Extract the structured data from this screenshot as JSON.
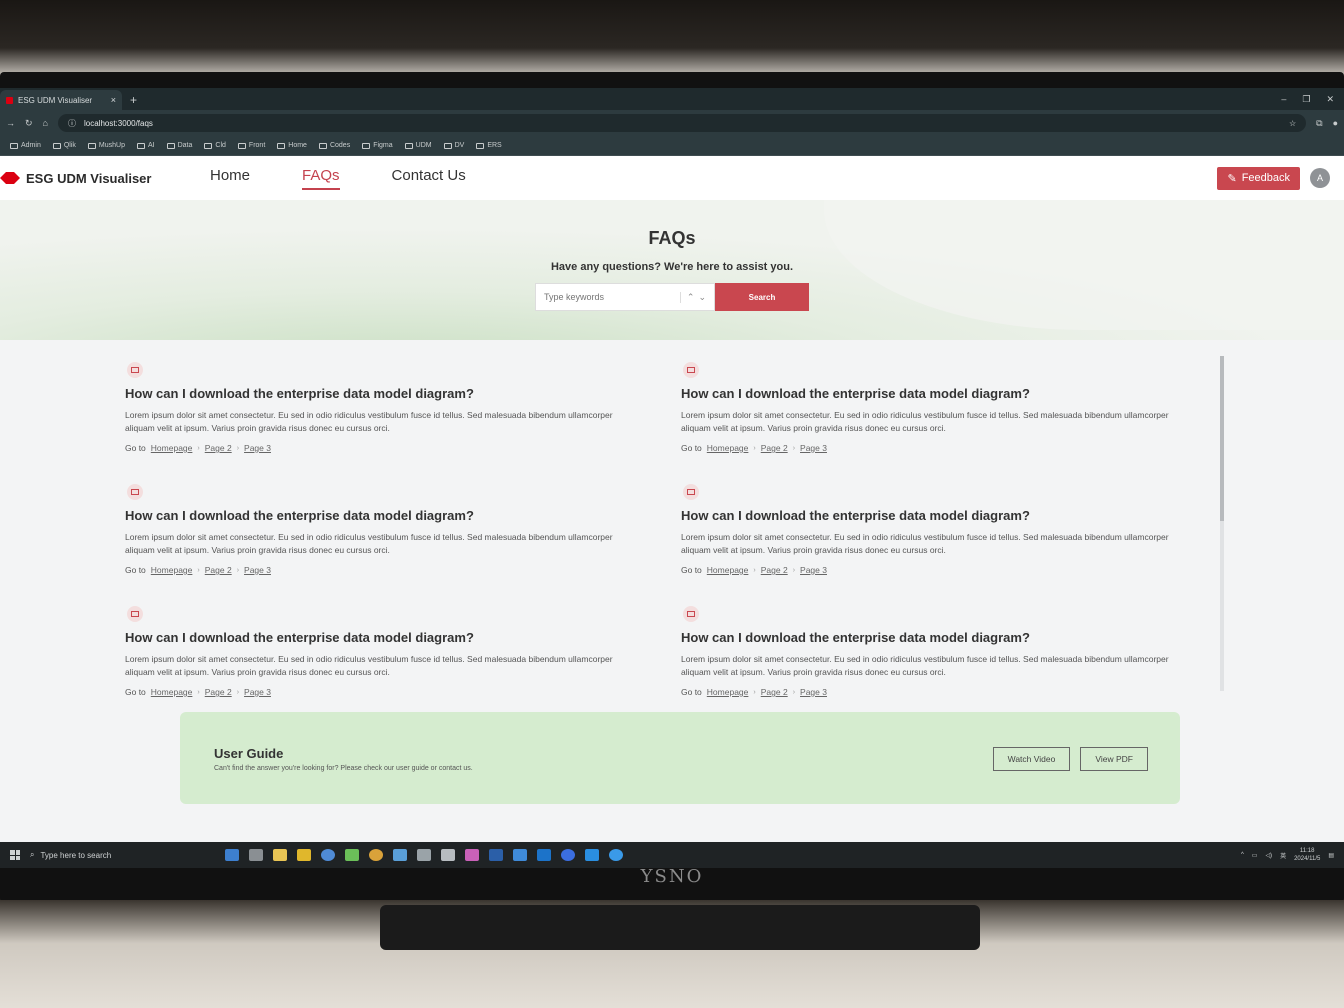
{
  "browser": {
    "tab_title": "ESG UDM Visualiser",
    "tab_close": "×",
    "new_tab": "+",
    "url": "localhost:3000/faqs",
    "bookmarks": [
      "Admin",
      "Qlik",
      "MushUp",
      "AI",
      "Data",
      "Cld",
      "Front",
      "Home",
      "Codes",
      "Figma",
      "UDM",
      "DV",
      "ERS"
    ]
  },
  "header": {
    "app_name": "ESG UDM Visualiser",
    "nav": [
      "Home",
      "FAQs",
      "Contact Us"
    ],
    "active_nav": "FAQs",
    "feedback_label": "Feedback",
    "avatar_initial": "A"
  },
  "hero": {
    "title": "FAQs",
    "subtitle": "Have any questions? We're here to assist you.",
    "search_placeholder": "Type keywords",
    "search_button": "Search"
  },
  "faqs": [
    {
      "question": "How can I download the enterprise data model diagram?",
      "answer": "Lorem ipsum dolor sit amet consectetur. Eu sed in odio ridiculus vestibulum fusce id tellus. Sed malesuada bibendum ullamcorper aliquam velit at ipsum. Varius proin gravida risus donec eu cursus orci.",
      "goto": "Go to",
      "links": [
        "Homepage",
        "Page 2",
        "Page 3"
      ]
    },
    {
      "question": "How can I download the enterprise data model diagram?",
      "answer": "Lorem ipsum dolor sit amet consectetur. Eu sed in odio ridiculus vestibulum fusce id tellus. Sed malesuada bibendum ullamcorper aliquam velit at ipsum. Varius proin gravida risus donec eu cursus orci.",
      "goto": "Go to",
      "links": [
        "Homepage",
        "Page 2",
        "Page 3"
      ]
    },
    {
      "question": "How can I download the enterprise data model diagram?",
      "answer": "Lorem ipsum dolor sit amet consectetur. Eu sed in odio ridiculus vestibulum fusce id tellus. Sed malesuada bibendum ullamcorper aliquam velit at ipsum. Varius proin gravida risus donec eu cursus orci.",
      "goto": "Go to",
      "links": [
        "Homepage",
        "Page 2",
        "Page 3"
      ]
    },
    {
      "question": "How can I download the enterprise data model diagram?",
      "answer": "Lorem ipsum dolor sit amet consectetur. Eu sed in odio ridiculus vestibulum fusce id tellus. Sed malesuada bibendum ullamcorper aliquam velit at ipsum. Varius proin gravida risus donec eu cursus orci.",
      "goto": "Go to",
      "links": [
        "Homepage",
        "Page 2",
        "Page 3"
      ]
    },
    {
      "question": "How can I download the enterprise data model diagram?",
      "answer": "Lorem ipsum dolor sit amet consectetur. Eu sed in odio ridiculus vestibulum fusce id tellus. Sed malesuada bibendum ullamcorper aliquam velit at ipsum. Varius proin gravida risus donec eu cursus orci.",
      "goto": "Go to",
      "links": [
        "Homepage",
        "Page 2",
        "Page 3"
      ]
    },
    {
      "question": "How can I download the enterprise data model diagram?",
      "answer": "Lorem ipsum dolor sit amet consectetur. Eu sed in odio ridiculus vestibulum fusce id tellus. Sed malesuada bibendum ullamcorper aliquam velit at ipsum. Varius proin gravida risus donec eu cursus orci.",
      "goto": "Go to",
      "links": [
        "Homepage",
        "Page 2",
        "Page 3"
      ]
    }
  ],
  "user_guide": {
    "title": "User Guide",
    "text": "Can't find the answer you're looking for? Please check our user guide or contact us.",
    "watch_video": "Watch Video",
    "view_pdf": "View PDF"
  },
  "taskbar": {
    "search_placeholder": "Type here to search",
    "time": "11:18",
    "date": "2024/11/5",
    "lang": "英"
  },
  "monitor_brand": "YSNO",
  "colors": {
    "accent": "#c9474f",
    "guide_bg": "#d5eccf",
    "logo_red": "#db0011"
  }
}
